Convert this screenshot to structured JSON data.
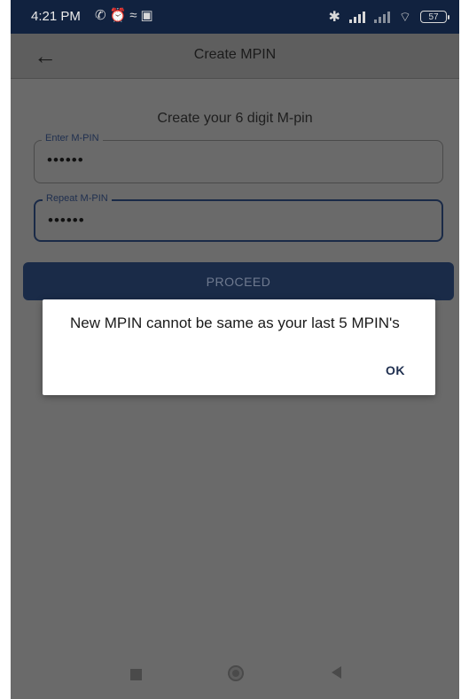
{
  "status_bar": {
    "time": "4:21 PM",
    "left_icons": [
      "missed-call-icon",
      "alarm-icon",
      "wifi-signal-icon",
      "notification-icon"
    ],
    "battery_level": "57"
  },
  "app_bar": {
    "back_icon": "arrow-left-icon",
    "title": "Create MPIN"
  },
  "form": {
    "subtitle": "Create your 6 digit M-pin",
    "enter_pin": {
      "label": "Enter M-PIN",
      "value": "••••••"
    },
    "repeat_pin": {
      "label": "Repeat M-PIN",
      "value": "••••••"
    },
    "proceed_label": "PROCEED"
  },
  "dialog": {
    "message": "New MPIN cannot be same as your last 5 MPIN's",
    "ok_label": "OK"
  },
  "nav_bar": {
    "icons": [
      "recent-apps-icon",
      "home-icon",
      "back-icon"
    ]
  },
  "colors": {
    "status_bar": "#11223f",
    "button": "#1a2b48",
    "scrim": "#6a6a6a",
    "dialog": "#ffffff"
  }
}
